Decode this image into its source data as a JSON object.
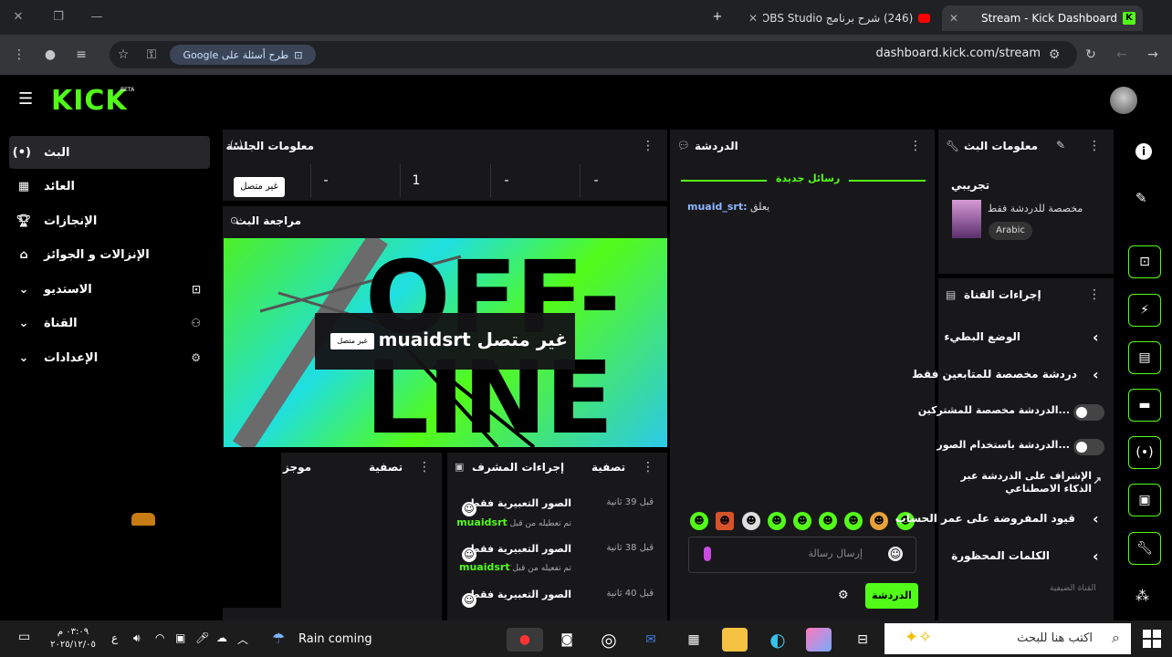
{
  "browser": {
    "tabs": [
      {
        "title": "Stream - Kick Dashboard",
        "active": true
      },
      {
        "title": "(246) شرح برنامج OBS Studio الأ",
        "active": false
      }
    ],
    "google_pill": "طرح أسئلة على Google",
    "url": "dashboard.kick.com/stream"
  },
  "kick": {
    "logo": "KICK",
    "beta": "BETA",
    "accent": "#53fc18"
  },
  "sidebar": {
    "items": [
      {
        "label": "البث",
        "icon": "broadcast-icon",
        "active": true
      },
      {
        "label": "العائد",
        "icon": "revenue-icon"
      },
      {
        "label": "الإنجازات",
        "icon": "trophy-icon"
      },
      {
        "label": "الإنزالات و الجوائز",
        "icon": "gift-icon"
      },
      {
        "label": "الاستديو",
        "icon": "studio-icon",
        "expandable": true
      },
      {
        "label": "القناة",
        "icon": "channel-icon",
        "expandable": true
      },
      {
        "label": "الإعدادات",
        "icon": "gear-icon",
        "expandable": true
      }
    ]
  },
  "session": {
    "title": "معلومات الجلسة",
    "status_badge": "غير متصل",
    "stats": [
      "-",
      "1",
      "-",
      "-"
    ]
  },
  "preview": {
    "title": "مراجعة البث",
    "offline_text": "غير متصل muaidsrt",
    "offline_badge": "غير متصل",
    "bg_text": "OFF-LINE"
  },
  "chat": {
    "title": "الدردشة",
    "new_messages": "رسائل جديدة",
    "messages": [
      {
        "user": "muaid_srt:",
        "text": "يعلق"
      }
    ],
    "input_placeholder": "إرسال رسالة",
    "send_label": "الدردشة"
  },
  "stream_info": {
    "title": "معلومات البث",
    "stream_title": "تجريبي",
    "subtitle": "مخصصة للدردشة فقط",
    "language": "Arabic"
  },
  "channel_actions": {
    "title": "إجراءات القناة",
    "items": [
      {
        "label": "الوضع البطيء",
        "control": "chevron"
      },
      {
        "label": "دردشة مخصصة للمتابعين فقط",
        "control": "chevron"
      },
      {
        "label": "...الدردشة مخصصة للمشتركين",
        "control": "toggle"
      },
      {
        "label": "...الدردشة باستخدام الصور",
        "control": "toggle"
      },
      {
        "label": "الإشراف على الدردشة عبر الذكاء الاصطناعي",
        "control": "link"
      },
      {
        "label": "قيود المفروضة على عمر الحساب",
        "control": "chevron"
      },
      {
        "label": "الكلمات المحظورة",
        "control": "chevron"
      }
    ],
    "more_label": "القناة الضيفية"
  },
  "mod_actions": {
    "title": "إجراءات المشرف",
    "filter_label": "تصفية",
    "rows": [
      {
        "action": "الصور التعبيرية فقط",
        "detail": "تم تعطيله من قبل",
        "user": "muaidsrt",
        "time": "قبل 39 ثانية"
      },
      {
        "action": "الصور التعبيرية فقط",
        "detail": "تم تفعيله من قبل",
        "user": "muaidsrt",
        "time": "قبل 38 ثانية"
      },
      {
        "action": "الصور التعبيرية فقط",
        "detail": "",
        "user": "",
        "time": "قبل 40 ثانية"
      }
    ]
  },
  "left_panel": {
    "filter_label": "تصفية",
    "title_partial": "موجز"
  },
  "taskbar": {
    "weather": "Rain coming",
    "search_placeholder": "اكتب هنا للبحث",
    "time": "٠٣:٠٩ م",
    "date": "٢٠٢٥/١٢/٠٥",
    "lang": "ع"
  }
}
